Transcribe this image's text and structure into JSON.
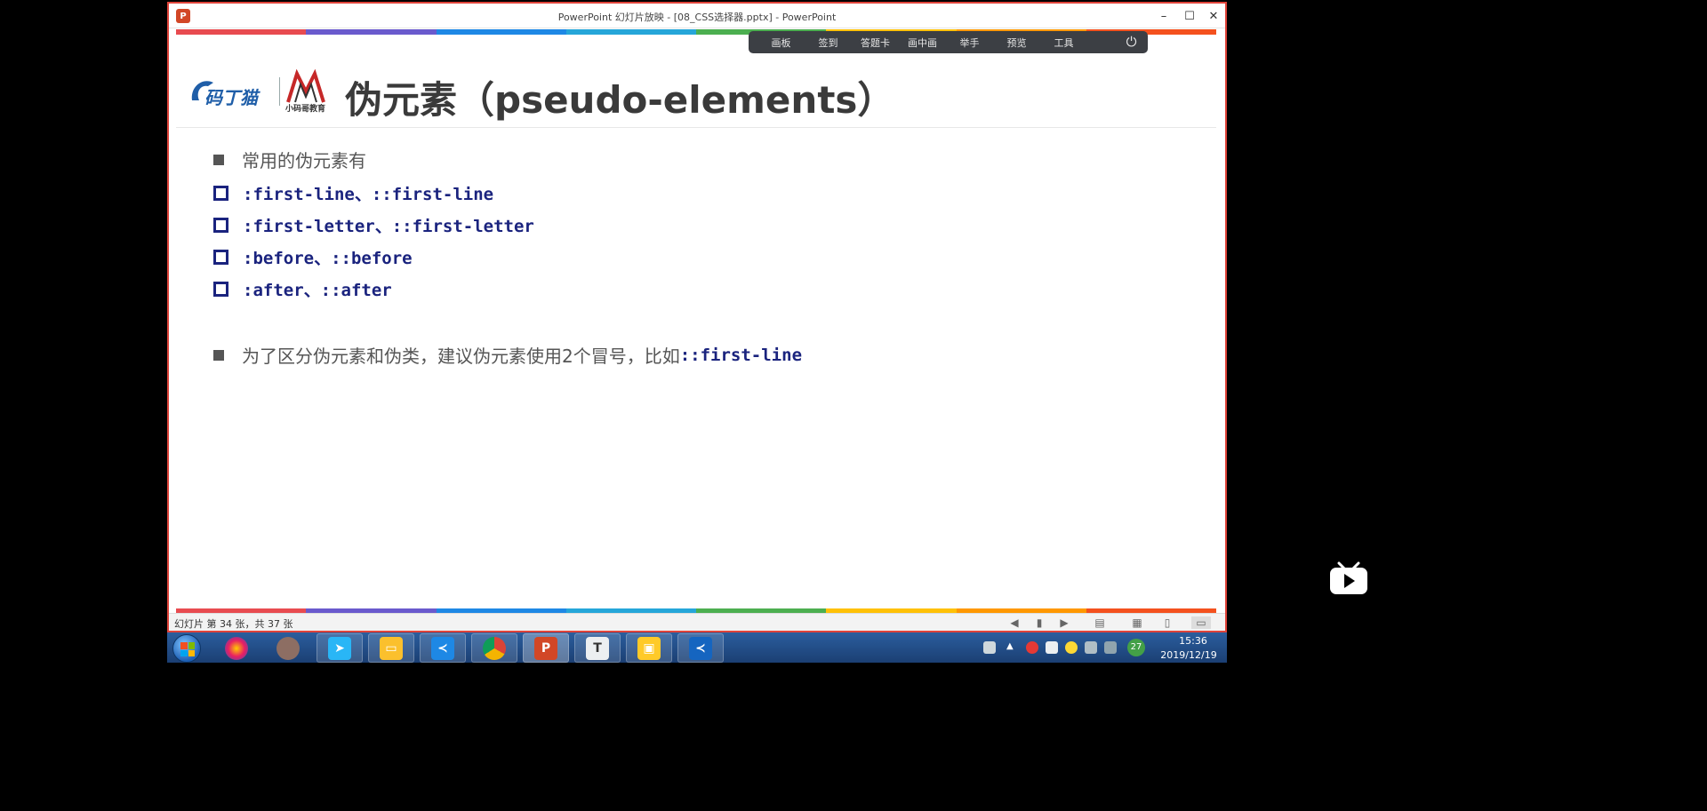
{
  "window": {
    "title": "PowerPoint 幻灯片放映 - [08_CSS选择器.pptx] - PowerPoint",
    "app_icon_label": "P",
    "min_glyph": "–",
    "max_glyph": "☐",
    "close_glyph": "✕"
  },
  "stripe_colors": [
    "#e84b50",
    "#6a5acd",
    "#1e88e5",
    "#26a6d9",
    "#4caf50",
    "#ffc107",
    "#ff9800",
    "#f4511e"
  ],
  "slide_toolbar": {
    "items": [
      "画板",
      "签到",
      "答题卡",
      "画中画",
      "举手",
      "预览",
      "工具"
    ],
    "power_glyph": "⏻"
  },
  "slide": {
    "title": "伪元素（pseudo-elements）",
    "logo_brand_text": "码丁猫",
    "logo_sub_text": "小码哥教育",
    "bullets": [
      {
        "type": "solid",
        "text": "常用的伪元素有"
      },
      {
        "type": "hollow",
        "code": ":first-line、::first-line"
      },
      {
        "type": "hollow",
        "code": ":first-letter、::first-letter"
      },
      {
        "type": "hollow",
        "code": ":before、::before"
      },
      {
        "type": "hollow",
        "code": ":after、::after"
      },
      {
        "type": "solid",
        "text": "为了区分伪元素和伪类，建议伪元素使用2个冒号，比如",
        "code": "::first-line"
      }
    ]
  },
  "statusbar": {
    "slide_info": "幻灯片 第 34 张，共 37 张"
  },
  "taskbar": {
    "apps": [
      "start",
      "color-app",
      "avatar",
      "arrow-app",
      "folder",
      "vscode",
      "chrome",
      "powerpoint",
      "typora",
      "paint",
      "vscode-2"
    ],
    "badge": "27",
    "time": "15:36",
    "date": "2019/12/19"
  }
}
